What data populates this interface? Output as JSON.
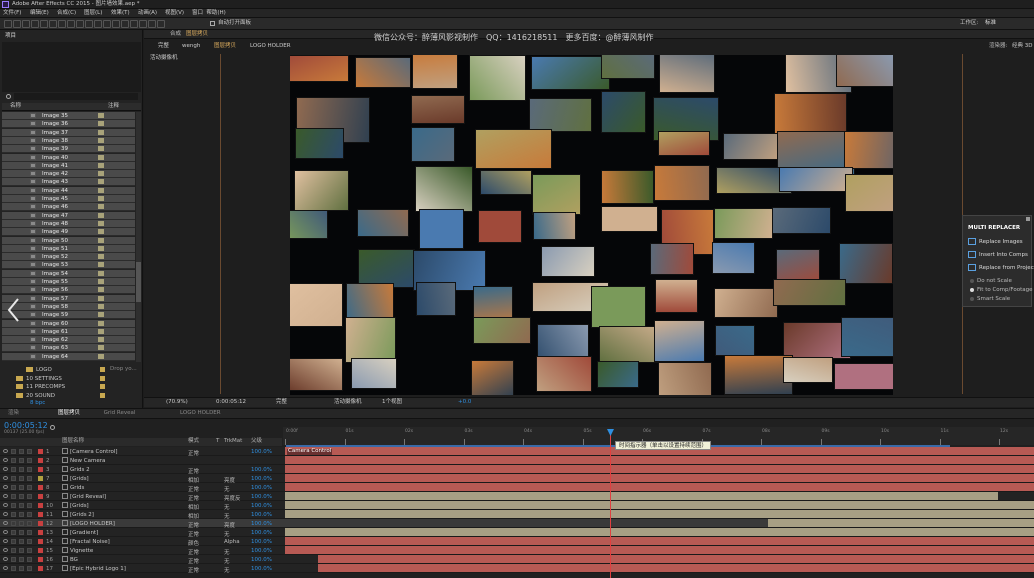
{
  "title": "Adobe After Effects CC 2015 - 图片墙效果.aep *",
  "menu": [
    "文件(F)",
    "编辑(E)",
    "合成(C)",
    "图层(L)",
    "效果(T)",
    "动画(A)",
    "视图(V)",
    "窗口",
    "帮助(H)"
  ],
  "toolbar": {
    "auto_open": "自动打开面板",
    "workspace_label": "工作区:",
    "workspace_value": "标准"
  },
  "project": {
    "tab": "项目",
    "search_icon": "search-icon",
    "col_name": "名称",
    "col_comment": "注释",
    "images": [
      "Image 35",
      "Image 36",
      "Image 37",
      "Image 38",
      "Image 39",
      "Image 40",
      "Image 41",
      "Image 42",
      "Image 43",
      "Image 44",
      "Image 45",
      "Image 46",
      "Image 47",
      "Image 48",
      "Image 49",
      "Image 50",
      "Image 51",
      "Image 52",
      "Image 53",
      "Image 54",
      "Image 55",
      "Image 56",
      "Image 57",
      "Image 58",
      "Image 59",
      "Image 60",
      "Image 61",
      "Image 62",
      "Image 63",
      "Image 64"
    ],
    "folders": [
      "LOGO",
      "10 SETTINGS",
      "11 PRECOMPS",
      "20 SOUND"
    ],
    "drop_text": "Drop yo...",
    "bpc": "8 bpc"
  },
  "comp": {
    "panel_label": "合成",
    "comp_name": "图层拷贝",
    "breadcrumb": [
      "完整",
      "wengh",
      "图层拷贝",
      "LOGO HOLDER"
    ],
    "watermark": "微信公众号：醉薄风影视制作　QQ：1416218511　更多百度：@醉薄风制作",
    "renderer_label": "渲染器:",
    "renderer_value": "经典 3D",
    "active_camera": "活动摄像机",
    "zoom": "(70.9%)",
    "timecode": "0:00:05:12",
    "resolution": "完整",
    "camera_view": "活动摄像机",
    "views": "1个视图",
    "exposure": "+0.0"
  },
  "plugin": {
    "title": "MULTI REPLACER",
    "items": [
      "Replace Images",
      "Insert Into Comps",
      "Replace from Project"
    ],
    "options": [
      "Do not Scale",
      "Fit to Comp/Footage",
      "Smart Scale"
    ],
    "selected_option": "Fit to Comp/Footage"
  },
  "timeline": {
    "tabs": [
      "渲染",
      "图层拷贝",
      "Grid Reveal",
      "LOGO HOLDER"
    ],
    "timecode": "0:00:05:12",
    "timecode_sub": "00137 (25.00 fps)",
    "col_source": "图层名称",
    "col_mode": "模式",
    "col_t": "T",
    "col_trkmat": "TrkMat",
    "col_parent": "父级",
    "tooltip": "时间指示器（单击以设置持续范围）",
    "ruler": [
      "0:00f",
      "01s",
      "02s",
      "03s",
      "04s",
      "05s",
      "06s",
      "07s",
      "08s",
      "09s",
      "10s",
      "11s",
      "12s"
    ],
    "layers": [
      {
        "n": "1",
        "name": "[Camera Control]",
        "mode": "正常",
        "matte": "",
        "opac": "100.0%",
        "label": "#c84040"
      },
      {
        "n": "2",
        "name": "New Camera",
        "mode": "",
        "matte": "",
        "opac": "",
        "label": "#c84040"
      },
      {
        "n": "3",
        "name": "Grids 2",
        "mode": "正常",
        "matte": "",
        "opac": "100.0%",
        "label": "#c84040"
      },
      {
        "n": "7",
        "name": "[Grids]",
        "mode": "相加",
        "matte": "亮度",
        "opac": "100.0%",
        "label": "#b0a040"
      },
      {
        "n": "8",
        "name": "Grids",
        "mode": "正常",
        "matte": "无",
        "opac": "100.0%",
        "label": "#c84040"
      },
      {
        "n": "9",
        "name": "[Grid Reveal]",
        "mode": "正常",
        "matte": "亮度反",
        "opac": "100.0%",
        "label": "#c84040"
      },
      {
        "n": "10",
        "name": "[Grids]",
        "mode": "相加",
        "matte": "无",
        "opac": "100.0%",
        "label": "#c84040"
      },
      {
        "n": "11",
        "name": "[Grids 2]",
        "mode": "相加",
        "matte": "无",
        "opac": "100.0%",
        "label": "#c84040"
      },
      {
        "n": "12",
        "name": "[LOGO HOLDER]",
        "mode": "正常",
        "matte": "亮度",
        "opac": "100.0%",
        "label": "#c84040"
      },
      {
        "n": "13",
        "name": "[Gradient]",
        "mode": "正常",
        "matte": "无",
        "opac": "100.0%",
        "label": "#c84040"
      },
      {
        "n": "14",
        "name": "[Fractal Noise]",
        "mode": "颜色",
        "matte": "Alpha",
        "opac": "100.0%",
        "label": "#c84040"
      },
      {
        "n": "15",
        "name": "Vignette",
        "mode": "正常",
        "matte": "无",
        "opac": "100.0%",
        "label": "#c84040"
      },
      {
        "n": "16",
        "name": "BG",
        "mode": "正常",
        "matte": "无",
        "opac": "100.0%",
        "label": "#c84040"
      },
      {
        "n": "17",
        "name": "[Epic Hybrid Logo 1]",
        "mode": "正常",
        "matte": "无",
        "opac": "100.0%",
        "label": "#c84040"
      }
    ],
    "first_bar_label": "Camera Control"
  },
  "colors": {
    "accent": "#2f8fe0",
    "bar_red": "#b75a54",
    "bar_tan": "#a79f84",
    "label_tan": "#a9a37a"
  }
}
